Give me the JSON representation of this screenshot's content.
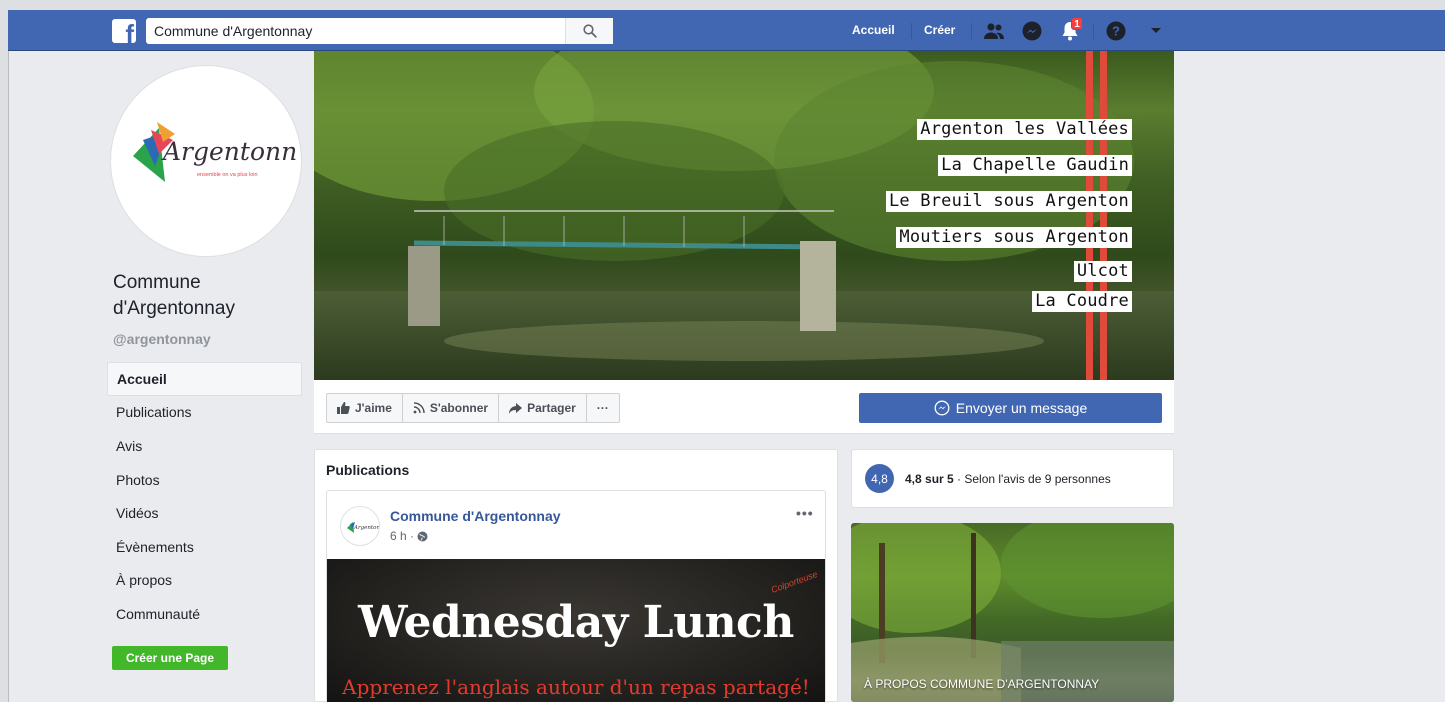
{
  "topbar": {
    "search_value": "Commune d'Argentonnay",
    "nav_home": "Accueil",
    "nav_create": "Créer",
    "notification_count": "1"
  },
  "page": {
    "name": "Commune d'Argentonnay",
    "handle": "@argentonnay",
    "logo_text": "Argentonnay",
    "logo_tagline": "ensemble on va plus loin"
  },
  "left_nav": {
    "items": [
      {
        "label": "Accueil",
        "active": true
      },
      {
        "label": "Publications"
      },
      {
        "label": "Avis"
      },
      {
        "label": "Photos"
      },
      {
        "label": "Vidéos"
      },
      {
        "label": "Évènements"
      },
      {
        "label": "À propos"
      },
      {
        "label": "Communauté"
      }
    ],
    "create_page": "Créer une Page"
  },
  "cover": {
    "labels": [
      "Argenton les Vallées",
      "La Chapelle Gaudin",
      "Le Breuil sous Argenton",
      "Moutiers sous Argenton",
      "Ulcot",
      "La Coudre"
    ]
  },
  "actions": {
    "like": "J'aime",
    "follow": "S'abonner",
    "share": "Partager",
    "more": "···",
    "message": "Envoyer un message"
  },
  "publications": {
    "title": "Publications",
    "post": {
      "author": "Commune d'Argentonnay",
      "time": "6 h ·",
      "image_title": "Wednesday Lunch",
      "image_subtitle": "Apprenez l'anglais autour d'un repas partagé!",
      "image_brand": "Colporteuse"
    }
  },
  "rating": {
    "score": "4,8",
    "summary_bold": "4,8 sur 5",
    "summary_rest": " · Selon l'avis de 9 personnes"
  },
  "about": {
    "label": "À PROPOS COMMUNE D'ARGENTONNAY"
  },
  "colors": {
    "brand_blue": "#4267b2",
    "green_button": "#42b72a",
    "link_blue": "#365899"
  }
}
